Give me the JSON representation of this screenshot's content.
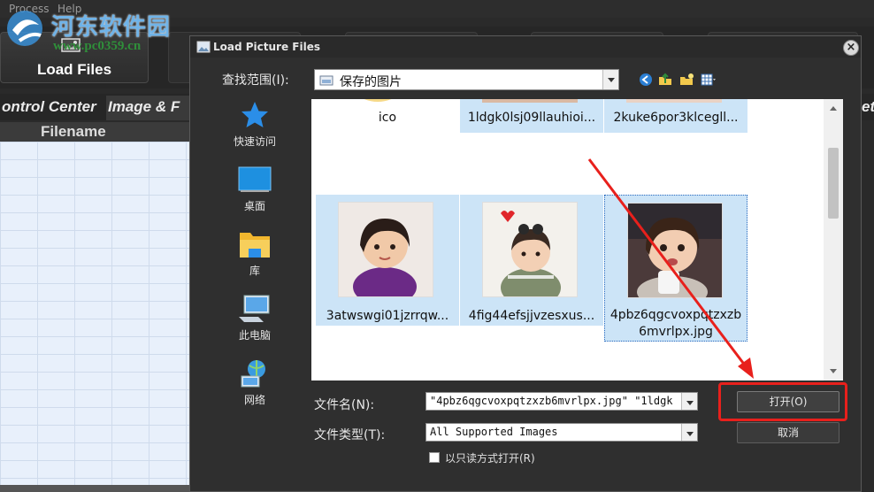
{
  "app": {
    "menu": [
      "Process",
      "Help"
    ],
    "load_files_label": "Load Files",
    "tabs": [
      "ontrol Center",
      "Image & F"
    ],
    "tab_right_fragment": "et",
    "column_header": "Filename"
  },
  "watermark": {
    "title": "河东软件园",
    "url": "www.pc0359.cn"
  },
  "dialog": {
    "title": "Load Picture Files",
    "close_glyph": "×",
    "look_in_label": "查找范围(I):",
    "look_in_value": "保存的图片",
    "places": [
      {
        "label": "快速访问",
        "icon": "star-icon"
      },
      {
        "label": "桌面",
        "icon": "desktop-icon"
      },
      {
        "label": "库",
        "icon": "library-icon"
      },
      {
        "label": "此电脑",
        "icon": "computer-icon"
      },
      {
        "label": "网络",
        "icon": "network-icon"
      }
    ],
    "files_top": [
      {
        "name": "ico",
        "selected": false
      },
      {
        "name": "1ldgk0lsj09llauhioi...",
        "selected": true
      },
      {
        "name": "2kuke6por3klcegll...",
        "selected": true
      }
    ],
    "files_bottom": [
      {
        "name": "3atwswgi01jzrrqw...",
        "selected": true
      },
      {
        "name": "4fig44efsjjvzesxus...",
        "selected": true
      },
      {
        "name_line1": "4pbz6qgcvoxpqtzxzb",
        "name_line2": "6mvrlpx.jpg",
        "selected": true
      }
    ],
    "file_name_label": "文件名(N):",
    "file_name_value": "\"4pbz6qgcvoxpqtzxzb6mvrlpx.jpg\" \"1ldgk",
    "file_type_label": "文件类型(T):",
    "file_type_value": "All Supported Images",
    "open_button": "打开(O)",
    "cancel_button": "取消",
    "readonly_label": "以只读方式打开(R)"
  },
  "colors": {
    "highlight": "#e8201c",
    "selection": "#cce4f7",
    "dialog_bg": "#2f2f2f"
  }
}
